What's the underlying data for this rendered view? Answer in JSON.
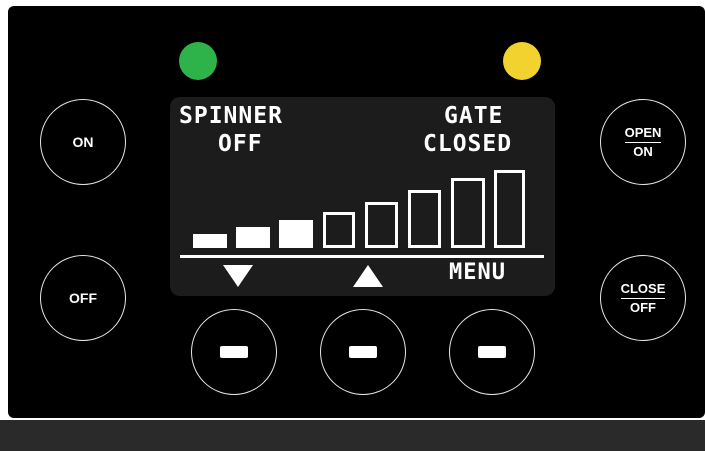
{
  "indicators": {
    "left_led": {
      "icon": "green-led-icon",
      "color": "#2db34a"
    },
    "right_led": {
      "icon": "yellow-led-icon",
      "color": "#f2d22e"
    }
  },
  "side_buttons": {
    "on_label": "ON",
    "off_label": "OFF",
    "open_on": {
      "top": "OPEN",
      "bottom": "ON"
    },
    "close_off": {
      "top": "CLOSE",
      "bottom": "OFF"
    }
  },
  "display": {
    "spinner_label": "SPINNER",
    "spinner_state": "OFF",
    "gate_label": "GATE",
    "gate_state": "CLOSED",
    "level_bars": {
      "total": 8,
      "filled": 3
    },
    "down_icon": "triangle-down-icon",
    "up_icon": "triangle-up-icon",
    "menu_label": "MENU"
  },
  "soft_keys": [
    {
      "icon": "dash-icon"
    },
    {
      "icon": "dash-icon"
    },
    {
      "icon": "dash-icon"
    }
  ]
}
